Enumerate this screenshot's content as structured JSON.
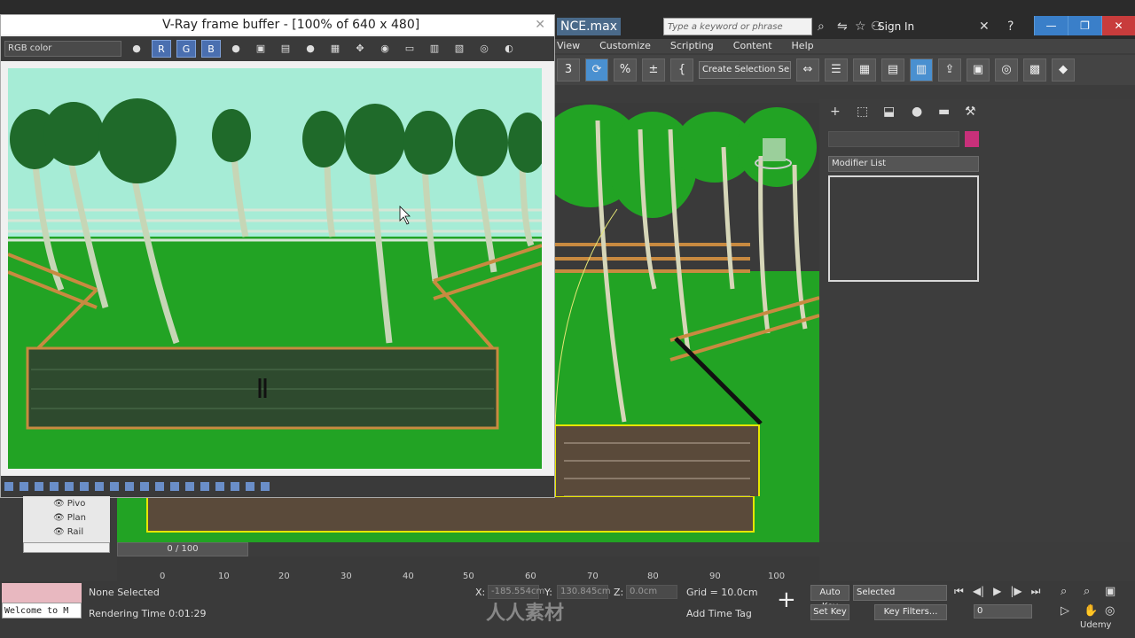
{
  "app": {
    "file_title": "NCE.max",
    "search_placeholder": "Type a keyword or phrase",
    "sign_in": "Sign In",
    "window_controls": [
      "—",
      "❐",
      "✕"
    ]
  },
  "menu": [
    "View",
    "Customize",
    "Scripting",
    "Content",
    "Help"
  ],
  "toolbar": {
    "selection_set": "Create Selection Se",
    "icons": [
      "3",
      "⟳",
      "%",
      "±",
      "{",
      "⇔",
      "☰",
      "▦",
      "▤",
      "▥",
      "⇪",
      "▣",
      "◎",
      "▩",
      "◆"
    ]
  },
  "vray": {
    "title": "V-Ray frame buffer - [100% of 640 x 480]",
    "channel": "RGB color",
    "channel_buttons": [
      "R",
      "G",
      "B"
    ],
    "tool_icons": [
      "●",
      "●",
      "▣",
      "▤",
      "●",
      "▦",
      "✥",
      "◉",
      "▭",
      "▥",
      "▧",
      "◎",
      "◐"
    ],
    "close": "✕"
  },
  "command_panel": {
    "modifier_list": "Modifier List",
    "tab_icons": [
      "+",
      "⬚",
      "⬓",
      "●",
      "▬",
      "⚒"
    ],
    "swatch_color": "#c8307a"
  },
  "layers": [
    "Pivo",
    "Plan",
    "Rail"
  ],
  "timeline": {
    "slider": "0 / 100",
    "ticks": [
      "0",
      "10",
      "20",
      "30",
      "40",
      "50",
      "60",
      "70",
      "80",
      "90",
      "100"
    ]
  },
  "status": {
    "listener": "Welcome to M",
    "selection": "None Selected",
    "render_time": "Rendering Time  0:01:29",
    "x_label": "X:",
    "x_val": "-185.554cm",
    "y_label": "Y:",
    "y_val": "130.845cm",
    "z_label": "Z:",
    "z_val": "0.0cm",
    "grid": "Grid = 10.0cm",
    "add_time_tag": "Add Time Tag",
    "auto_key": "Auto Key",
    "set_key": "Set Key",
    "key_target": "Selected",
    "key_filters": "Key Filters...",
    "frame": "0",
    "playback": [
      "⏮",
      "◀|",
      "▶",
      "|▶",
      "⏭"
    ],
    "watermark": "人人素材",
    "brand": "Udemy"
  }
}
